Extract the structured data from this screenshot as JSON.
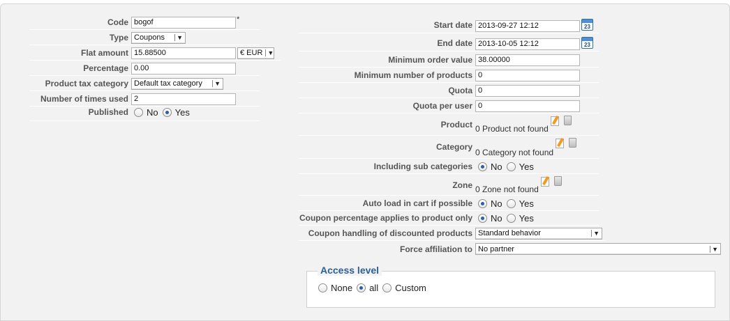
{
  "left": {
    "code": {
      "label": "Code",
      "value": "bogof",
      "required": "*"
    },
    "type": {
      "label": "Type",
      "value": "Coupons"
    },
    "flat_amount": {
      "label": "Flat amount",
      "value": "15.88500",
      "currency": "€ EUR"
    },
    "percentage": {
      "label": "Percentage",
      "value": "0.00"
    },
    "tax_category": {
      "label": "Product tax category",
      "value": "Default tax category"
    },
    "times_used": {
      "label": "Number of times used",
      "value": "2"
    },
    "published": {
      "label": "Published",
      "options": [
        "No",
        "Yes"
      ],
      "selected": "Yes"
    }
  },
  "right": {
    "start_date": {
      "label": "Start date",
      "value": "2013-09-27 12:12",
      "icon": "calendar-icon",
      "icon_text": "23"
    },
    "end_date": {
      "label": "End date",
      "value": "2013-10-05 12:12",
      "icon": "calendar-icon",
      "icon_text": "23"
    },
    "min_order": {
      "label": "Minimum order value",
      "value": "38.00000"
    },
    "min_products": {
      "label": "Minimum number of products",
      "value": "0"
    },
    "quota": {
      "label": "Quota",
      "value": "0"
    },
    "quota_user": {
      "label": "Quota per user",
      "value": "0"
    },
    "product": {
      "label": "Product",
      "value": "0 Product not found"
    },
    "category": {
      "label": "Category",
      "value": "0 Category not found"
    },
    "sub_categories": {
      "label": "Including sub categories",
      "options": [
        "No",
        "Yes"
      ],
      "selected": "No"
    },
    "zone": {
      "label": "Zone",
      "value": "0 Zone not found"
    },
    "auto_load": {
      "label": "Auto load in cart if possible",
      "options": [
        "No",
        "Yes"
      ],
      "selected": "No"
    },
    "pct_product_only": {
      "label": "Coupon percentage applies to product only",
      "options": [
        "No",
        "Yes"
      ],
      "selected": "No"
    },
    "discounted_handling": {
      "label": "Coupon handling of discounted products",
      "value": "Standard behavior"
    },
    "affiliation": {
      "label": "Force affiliation to",
      "value": "No partner"
    }
  },
  "access": {
    "legend": "Access level",
    "options": [
      "None",
      "all",
      "Custom"
    ],
    "selected": "all"
  },
  "colors": {
    "panel": "#f2f2f2",
    "legend": "#2b5f97",
    "radio_dot": "#2a5fa8"
  }
}
